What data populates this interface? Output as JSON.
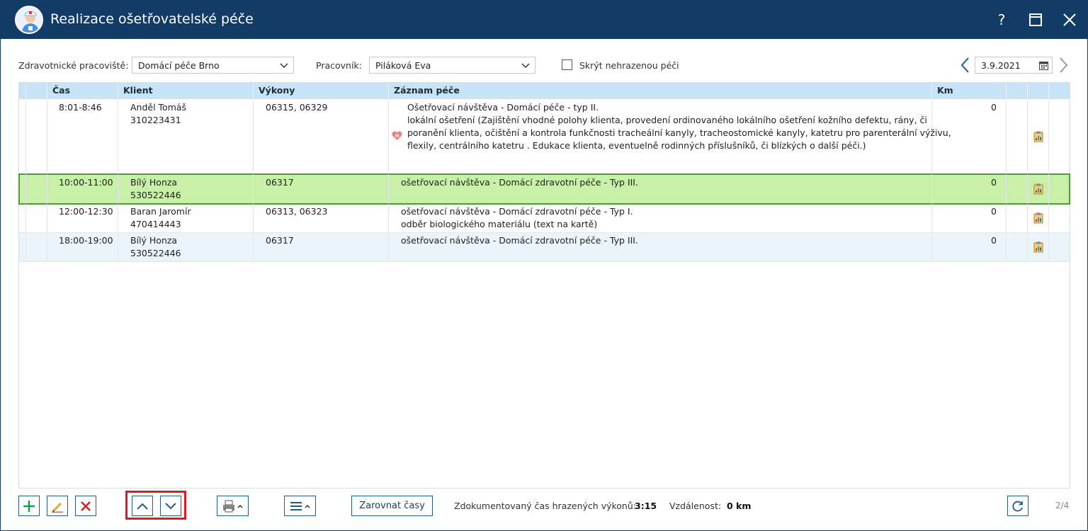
{
  "window": {
    "title": "Realizace ošetřovatelské péče",
    "help_label": "?"
  },
  "filters": {
    "workplace_label": "Zdravotnické pracoviště:",
    "workplace_value": "Domácí péče Brno",
    "worker_label": "Pracovník:",
    "worker_value": "Piláková Eva",
    "hide_unpaid_label": "Skrýt nehrazenou péči",
    "hide_unpaid_checked": false,
    "date": "3.9.2021"
  },
  "table": {
    "columns": [
      "Čas",
      "Klient",
      "Výkony",
      "Záznam péče",
      "Km"
    ],
    "rows": [
      {
        "time": "8:01-8:46",
        "client_name": "Anděl Tomáš",
        "client_id": "310223431",
        "procedures": "06315, 06329",
        "record_lines": [
          "Ošetřovací návštěva - Domácí péče - typ II.",
          "lokální ošetření (Zajištění vhodné polohy klienta, provedení ordinovaného lokálního ošetření kožního defektu, rány, či",
          "poranění klienta, očištění a kontrola funkčnosti tracheální kanyly, tracheostomické kanyly, katetru pro parenterální výživu,",
          "flexily, centrálního katetru . Edukace klienta, eventuelně rodinných příslušníků, či blízkých o další péči.)"
        ],
        "km": "0",
        "state": "normal",
        "has_h_icon": true
      },
      {
        "time": "10:00-11:00",
        "client_name": "Bílý Honza",
        "client_id": "530522446",
        "procedures": "06317",
        "record_lines": [
          "ošetřovací návštěva - Domácí zdravotní péče - Typ III."
        ],
        "km": "0",
        "state": "selected",
        "has_h_icon": false
      },
      {
        "time": "12:00-12:30",
        "client_name": "Baran Jaromír",
        "client_id": "470414443",
        "procedures": "06313, 06323",
        "record_lines": [
          "ošetřovací návštěva - Domácí zdravotní péče - Typ I.",
          "odběr biologického materiálu (text na kartě)"
        ],
        "km": "0",
        "state": "normal",
        "has_h_icon": false
      },
      {
        "time": "18:00-19:00",
        "client_name": "Bílý Honza",
        "client_id": "530522446",
        "procedures": "06317",
        "record_lines": [
          "ošetřovací návštěva - Domácí zdravotní péče - Typ III."
        ],
        "km": "0",
        "state": "alt",
        "has_h_icon": false
      }
    ]
  },
  "toolbar": {
    "align_times_label": "Zarovnat časy",
    "documented_time_label": "Zdokumentovaný čas hrazených výkonů:",
    "documented_time_value": "3:15",
    "distance_label": "Vzdálenost:",
    "distance_value": "0 km",
    "page_indicator": "2/4"
  },
  "colors": {
    "title_bar": "#123c66",
    "header_bg": "#c7e3f7",
    "selected_row": "#c8f0a8",
    "selected_border": "#4f9a3a",
    "alt_row": "#eaf4fb",
    "highlight": "#d81e1e",
    "add_icon": "#1a9a5a",
    "delete_icon": "#d32020"
  },
  "icons": [
    "nurse-avatar-icon",
    "help-icon",
    "maximize-icon",
    "close-icon",
    "chevron-down-icon",
    "calendar-icon",
    "arrow-left-icon",
    "arrow-right-icon",
    "hospital-heart-icon",
    "clipboard-chart-icon",
    "plus-icon",
    "pencil-icon",
    "x-icon",
    "move-up-icon",
    "move-down-icon",
    "printer-icon",
    "menu-icon",
    "refresh-icon"
  ]
}
